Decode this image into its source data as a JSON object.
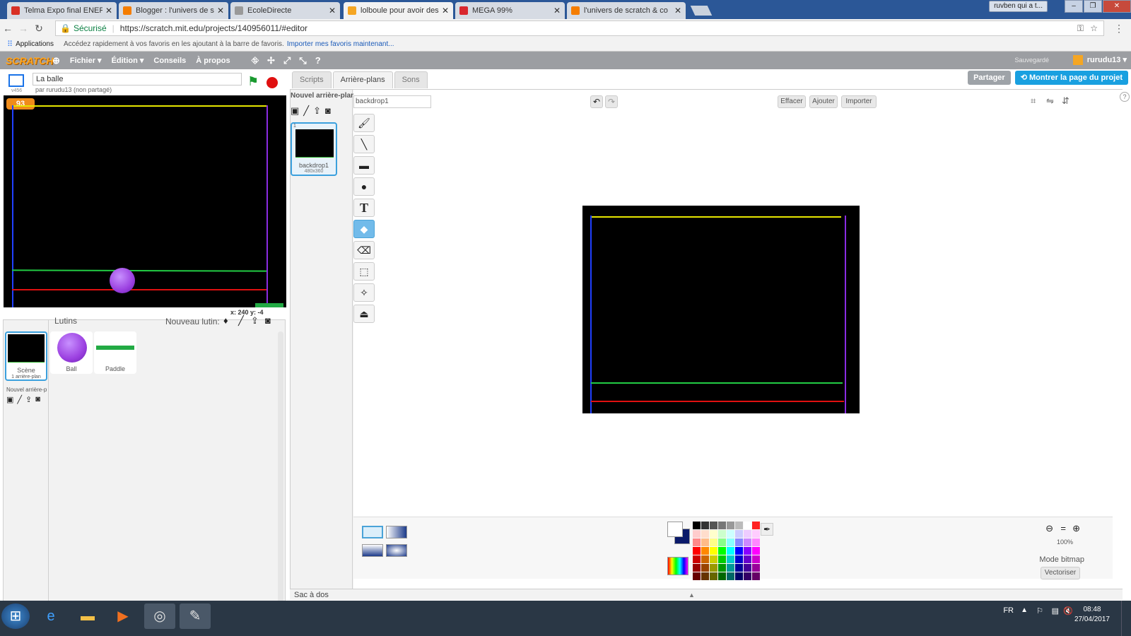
{
  "browser": {
    "tabs": [
      {
        "title": "Telma Expo final ENERGIE",
        "color": "#d93025"
      },
      {
        "title": "Blogger : l'univers de scr",
        "color": "#f57d00"
      },
      {
        "title": "EcoleDirecte",
        "color": "#777777"
      },
      {
        "title": "lolboule pour avoir des p",
        "color": "#f5a623"
      },
      {
        "title": "MEGA 99%",
        "color": "#d9272e"
      },
      {
        "title": "l'univers de scratch & co",
        "color": "#f57d00"
      }
    ],
    "user_badge": "ruvben qui a t...",
    "secure_label": "Sécurisé",
    "url": "https://scratch.mit.edu/projects/140956011/#editor",
    "bookmarks_apps": "Applications",
    "bookmarks_hint": "Accédez rapidement à vos favoris en les ajoutant à la barre de favoris.",
    "bookmarks_link": "Importer mes favoris maintenant..."
  },
  "scratch_menu": {
    "logo": "SCRATCH",
    "file": "Fichier ▾",
    "edit": "Édition ▾",
    "tips": "Conseils",
    "about": "À propos",
    "saved": "Sauvegardé",
    "user": "rurudu13 ▾"
  },
  "project": {
    "name": "La balle",
    "byline": "par rurudu13 (non partagé)",
    "version": "v456",
    "score": "93",
    "coords": "x: 240   y: -4"
  },
  "tabs": [
    "Scripts",
    "Arrière-plans",
    "Sons"
  ],
  "share_label": "Partager",
  "see_project_label": "Montrer la page du projet",
  "sprites": {
    "header": "Lutins",
    "new_sprite": "Nouveau lutin:",
    "scene_label": "Scène",
    "scene_sub": "1 arrière-plan",
    "new_backdrop": "Nouvel arrière-p",
    "items": [
      "Ball",
      "Paddle"
    ]
  },
  "backdrops": {
    "header": "Nouvel arrière-plan:",
    "item_index": "1",
    "item_name": "backdrop1",
    "item_size": "480x360"
  },
  "paint": {
    "costume_name": "backdrop1",
    "clear": "Effacer",
    "add": "Ajouter",
    "import": "Importer",
    "zoom": "100%",
    "mode": "Mode bitmap",
    "vectorize": "Vectoriser"
  },
  "backpack": "Sac à dos",
  "taskbar": {
    "lang": "FR",
    "time": "08:48",
    "date": "27/04/2017"
  },
  "colors": {
    "stage_yellow": "#e6e600",
    "stage_blue": "#2040ff",
    "stage_purple": "#8a2be2",
    "stage_green": "#22cc44",
    "stage_red": "#e01010",
    "ball": "#9b40e0",
    "accent": "#19a0e0"
  }
}
